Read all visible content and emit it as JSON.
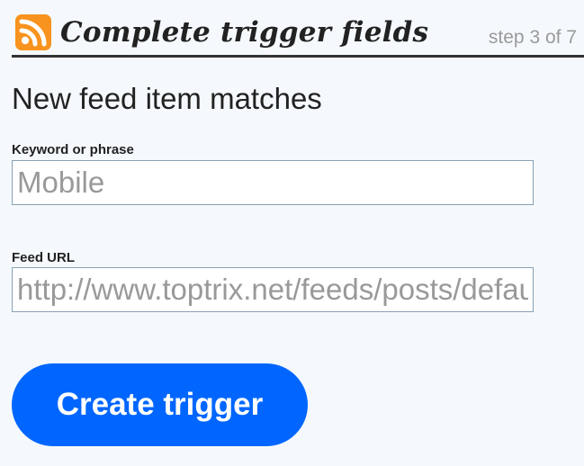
{
  "header": {
    "icon": "rss-feed-icon",
    "icon_color": "#f7931e",
    "title": "Complete trigger fields",
    "step": "step 3 of 7"
  },
  "trigger": {
    "name": "New feed item matches"
  },
  "fields": [
    {
      "label": "Keyword or phrase",
      "value": "Mobile"
    },
    {
      "label": "Feed URL",
      "value": "http://www.toptrix.net/feeds/posts/default"
    }
  ],
  "actions": {
    "create_label": "Create trigger",
    "create_color": "#0066ff"
  }
}
